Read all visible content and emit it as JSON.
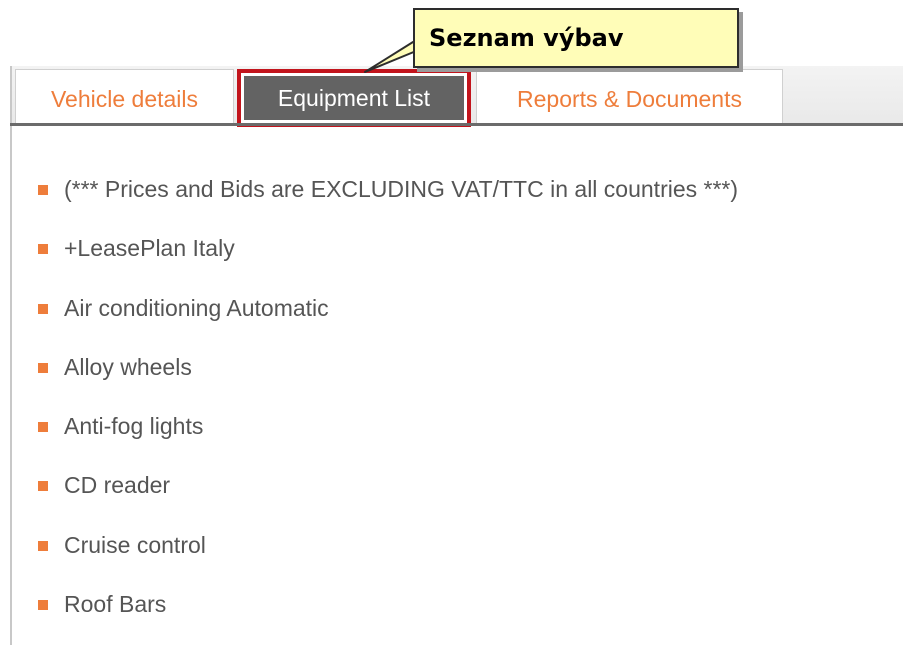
{
  "callout": {
    "text": "Seznam výbav"
  },
  "tabs": {
    "vehicle_details": "Vehicle details",
    "equipment_list": "Equipment List",
    "reports_documents": "Reports & Documents"
  },
  "equipment": [
    "(*** Prices and Bids are EXCLUDING VAT/TTC in all countries ***)",
    "+LeasePlan Italy",
    "Air conditioning Automatic",
    "Alloy wheels",
    "Anti-fog lights",
    "CD reader",
    "Cruise control",
    "Roof Bars"
  ],
  "colors": {
    "accent": "#ee7d3b",
    "active_tab_bg": "#636363",
    "highlight_border": "#c2141c",
    "callout_bg": "#fffdb8",
    "list_text": "#555555"
  },
  "icons": {
    "bullet": "orange-square-bullet-icon"
  }
}
